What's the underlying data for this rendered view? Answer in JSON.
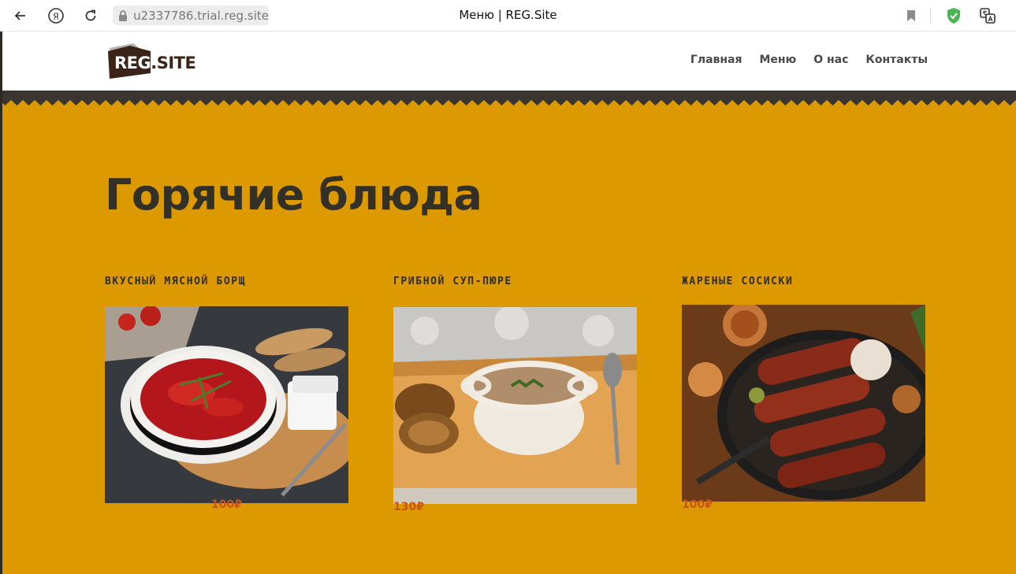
{
  "browser": {
    "url": "u2337786.trial.reg.site",
    "tab_title": "Меню | REG.Site"
  },
  "site": {
    "logo_reg": "REG",
    "logo_site": ".SITE",
    "nav": [
      "Главная",
      "Меню",
      "О нас",
      "Контакты"
    ]
  },
  "section": {
    "title": "Горячие блюда"
  },
  "dishes": [
    {
      "name": "ВКУСНЫЙ МЯСНОЙ БОРЩ",
      "price": "100₽",
      "image": "borscht-photo"
    },
    {
      "name": "ГРИБНОЙ СУП-ПЮРЕ",
      "price": "130₽",
      "image": "mushroom-soup-photo"
    },
    {
      "name": "ЖАРЕНЫЕ СОСИСКИ",
      "price": "100₽",
      "image": "fried-sausages-photo"
    }
  ],
  "colors": {
    "page_background": "#dd9900",
    "band": "#3a3530",
    "heading": "#333028",
    "price": "#c9541a",
    "logo_brown": "#3a2418"
  }
}
